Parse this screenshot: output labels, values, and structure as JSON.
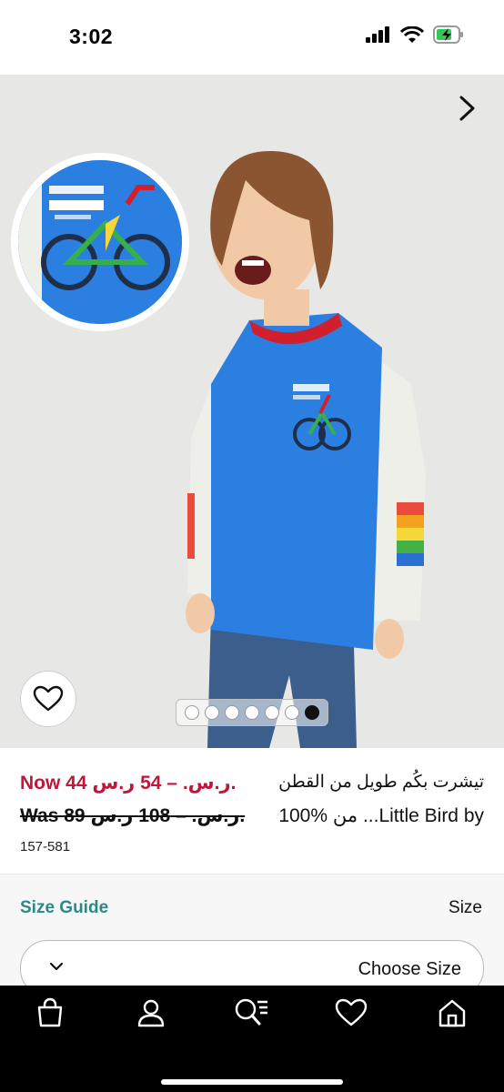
{
  "status_bar": {
    "time": "3:02"
  },
  "product": {
    "price_now": "Now 44 ر.س. – 54 ر.س.",
    "price_was": "Was 89 ر.س. – 108 ر.س.",
    "code": "157-581",
    "title_line1": "تيشرت بكُم طويل من القطن",
    "title_line2": "100% من ...Little Bird by"
  },
  "gallery": {
    "dot_count": 7,
    "active_index": 6
  },
  "size": {
    "guide_label": "Size Guide",
    "label": "Size",
    "choose_label": "Choose Size"
  },
  "tabs": [
    "bag-icon",
    "account-icon",
    "search-icon",
    "wishlist-icon",
    "home-icon"
  ],
  "colors": {
    "price_red": "#c1163a",
    "accent_teal": "#2a8a86",
    "shirt_blue": "#2b7fe0"
  }
}
